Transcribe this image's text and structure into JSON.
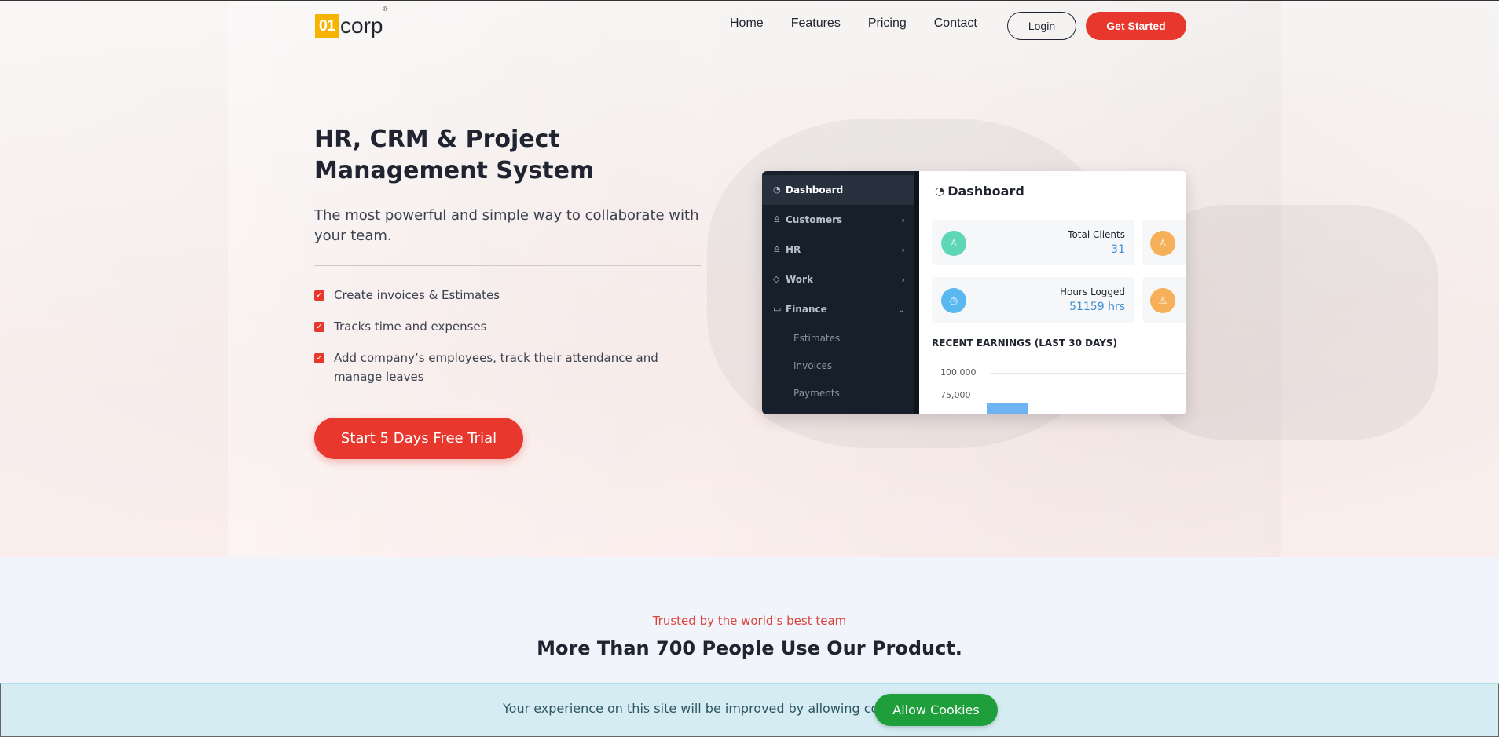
{
  "nav": {
    "logo_mark": "01",
    "logo_word": "corp",
    "logo_reg": "®",
    "links": [
      "Home",
      "Features",
      "Pricing",
      "Contact"
    ],
    "login_label": "Login",
    "get_started_label": "Get Started"
  },
  "hero": {
    "title": "HR, CRM & Project Management System",
    "subtitle": "The most powerful and simple way to collaborate with your team.",
    "features": [
      "Create invoices & Estimates",
      "Tracks time and expenses",
      "Add company’s employees, track their attendance and manage leaves"
    ],
    "cta_label": "Start 5 Days Free Trial"
  },
  "dashboard": {
    "sidebar": {
      "items": [
        "Dashboard",
        "Customers",
        "HR",
        "Work",
        "Finance"
      ],
      "finance_sub": [
        "Estimates",
        "Invoices",
        "Payments"
      ]
    },
    "title": "Dashboard",
    "cards": [
      {
        "label": "Total Clients",
        "value": "31",
        "color": "#5fd6b6"
      },
      {
        "label": "Hours Logged",
        "value": "51159 hrs",
        "color": "#5ab8f0"
      }
    ],
    "side_card_colors": [
      "#f6b05a",
      "#f6b05a"
    ],
    "earnings_title": "RECENT EARNINGS (LAST 30 DAYS)",
    "chart_ticks": [
      "100,000",
      "75,000"
    ]
  },
  "trusted": {
    "tag": "Trusted by the world's best team",
    "title": "More Than 700 People Use Our Product."
  },
  "cookie": {
    "text": "Your experience on this site will be improved by allowing cookies.",
    "button_label": "Allow Cookies"
  },
  "colors": {
    "accent": "#e8382d",
    "cookie_button": "#1f9e3c",
    "sidebar_bg": "#171f2a"
  }
}
